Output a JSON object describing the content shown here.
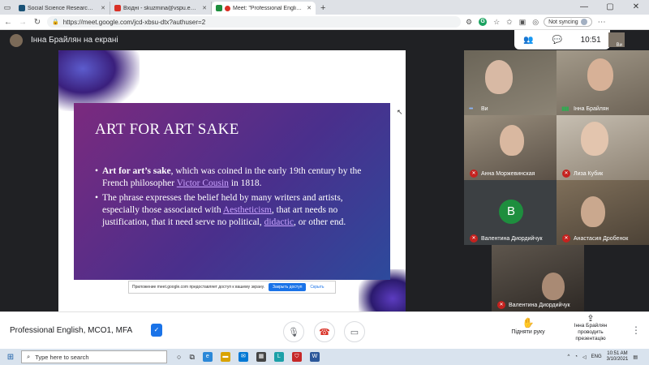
{
  "browser": {
    "tabs": [
      {
        "title": "Social Science Research Network",
        "color": "#1a5276"
      },
      {
        "title": "Вхідні - skuzmina@vspu.edu.ua",
        "color": "#d93025"
      },
      {
        "title": "Meet: \"Professional English...",
        "color": "#1e8e3e",
        "active": true
      }
    ],
    "url": "https://meet.google.com/jcd-xbsu-dtx?authuser=2",
    "profile_button": "Not syncing"
  },
  "meet": {
    "presenter_banner": "Інна Брайлян на екрані",
    "clock": "10:51",
    "self_label": "Ви",
    "meeting_title": "Professional English, MCO1, MFA",
    "raise_hand_label": "Підняти руку",
    "presenting_label_line1": "Інна Брайлян",
    "presenting_label_line2": "проводить презентацію"
  },
  "slide": {
    "title": "ART FOR ART SAKE",
    "bullet1_bold": "Art for art’s sake",
    "bullet1_text_a": ", which was coined in the early 19th century by the French philosopher ",
    "bullet1_link": "Victor Cousin",
    "bullet1_text_b": " in 1818.",
    "bullet2_text_a": "The phrase expresses the belief held by many writers and artists, especially those associated with ",
    "bullet2_link1": "Aestheticism",
    "bullet2_text_b": ", that art needs no justification, that it need serve no political, ",
    "bullet2_link2": "didactic",
    "bullet2_text_c": ", or other end.",
    "share_notice": "Приложение meet.google.com предоставляет доступ к вашему экрану.",
    "share_stop": "Закрыть доступ",
    "share_hide": "Скрыть"
  },
  "participants": [
    {
      "name": "Ви",
      "status": "dots"
    },
    {
      "name": "Інна Брайлян",
      "status": "speaking"
    },
    {
      "name": "Анна Моржевинская",
      "status": "muted"
    },
    {
      "name": "Лиза Кубик",
      "status": "muted"
    },
    {
      "name": "Валентина Диордийчук",
      "status": "muted",
      "avatar_letter": "B"
    },
    {
      "name": "Анастасия Дробенок",
      "status": "muted"
    },
    {
      "name": "Валентина Диордийчук",
      "status": "muted"
    }
  ],
  "taskbar": {
    "search_placeholder": "Type here to search",
    "lang": "ENG",
    "time": "10:51 AM",
    "date": "3/10/2021"
  }
}
